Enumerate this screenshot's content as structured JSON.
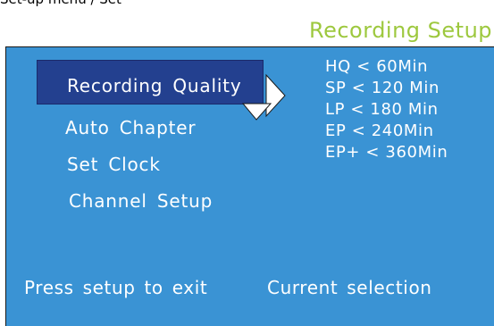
{
  "top_cut_text": "Set-up menu / Set",
  "screen_title": "Recording Setup",
  "menu": {
    "items": [
      {
        "label": "Recording  Quality",
        "selected": true
      },
      {
        "label": "Auto  Chapter",
        "selected": false
      },
      {
        "label": "Set  Clock",
        "selected": false
      },
      {
        "label": "Channel  Setup",
        "selected": false
      }
    ]
  },
  "options": [
    "HQ < 60Min",
    "SP  < 120 Min",
    "LP  < 180 Min",
    "EP  < 240Min",
    "EP+ < 360Min"
  ],
  "footer": {
    "exit_hint": "Press  setup  to  exit",
    "current_selection": "Current  selection"
  },
  "colors": {
    "panel_bg": "#3a93d4",
    "highlight_bg": "#23408f",
    "title": "#9dc83e",
    "text": "#ffffff"
  },
  "icons": {
    "right_arrow": "triangle-right-icon",
    "down_arrow": "triangle-down-icon"
  }
}
